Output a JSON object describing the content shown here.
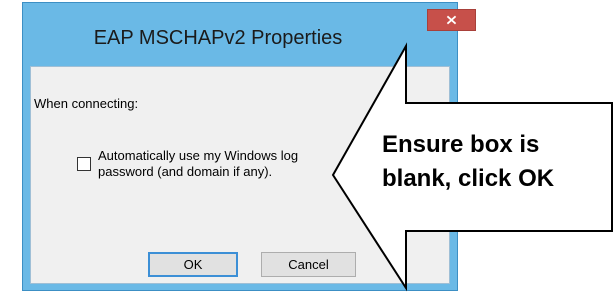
{
  "dialog": {
    "title": "EAP MSCHAPv2 Properties",
    "close_icon": "close-icon",
    "close_color": "#c7504a",
    "frame_color": "#6ab9e6",
    "section_label": "When connecting:",
    "checkbox": {
      "checked": false,
      "label_line1": "Automatically use my Windows log",
      "label_line2": "password (and domain if any)."
    },
    "ok_label": "OK",
    "cancel_label": "Cancel"
  },
  "callout": {
    "line1": "Ensure box is",
    "line2": "blank, click OK"
  }
}
